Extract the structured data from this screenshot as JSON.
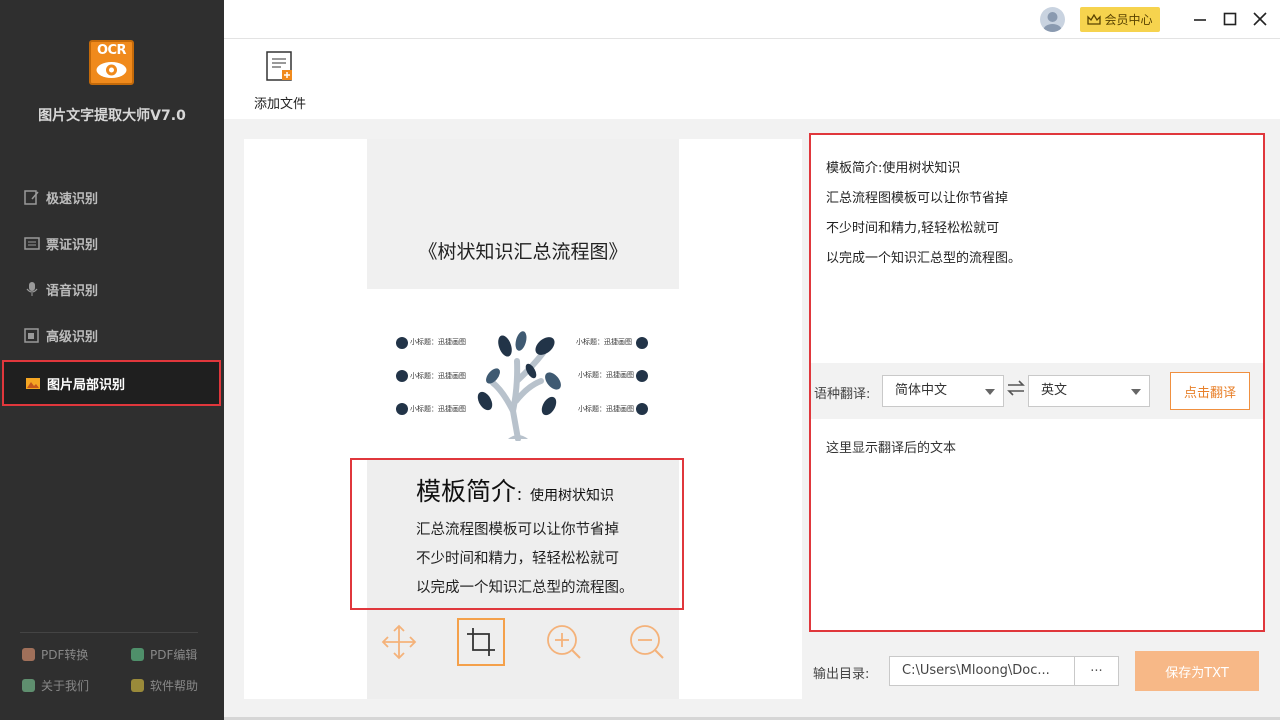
{
  "app": {
    "logo_text": "OCR",
    "title": "图片文字提取大师V7.0"
  },
  "sidebar": {
    "items": [
      {
        "label": "极速识别",
        "icon": "speed-icon"
      },
      {
        "label": "票证识别",
        "icon": "ticket-icon"
      },
      {
        "label": "语音识别",
        "icon": "microphone-icon"
      },
      {
        "label": "高级识别",
        "icon": "advanced-icon"
      },
      {
        "label": "图片局部识别",
        "icon": "image-crop-icon",
        "active": true
      }
    ],
    "bottom_links": [
      {
        "label": "PDF转换",
        "icon": "pdf-convert-icon"
      },
      {
        "label": "PDF编辑",
        "icon": "pdf-edit-icon"
      },
      {
        "label": "关于我们",
        "icon": "about-icon"
      },
      {
        "label": "软件帮助",
        "icon": "help-icon"
      }
    ]
  },
  "titlebar": {
    "member_label": "会员中心"
  },
  "toolbar": {
    "add_file_label": "添加文件"
  },
  "preview": {
    "slide_title": "《树状知识汇总流程图》",
    "mini_labels": [
      "小标题：迅捷画图",
      "小标题：迅捷画图",
      "小标题：迅捷画图",
      "小标题：迅捷画图",
      "小标题：迅捷画图",
      "小标题：迅捷画图"
    ],
    "desc_heading_big": "模板简介",
    "desc_heading_small": "：使用树状知识",
    "desc_lines": [
      "汇总流程图模板可以让你节省掉",
      "不少时间和精力，轻轻松松就可",
      "以完成一个知识汇总型的流程图。"
    ]
  },
  "result": {
    "lines": [
      "模板简介:使用树状知识",
      "汇总流程图模板可以让你节省掉",
      "不少时间和精力,轻轻松松就可",
      "以完成一个知识汇总型的流程图。"
    ],
    "translate_label": "语种翻译:",
    "source_lang": "简体中文",
    "target_lang": "英文",
    "translate_button": "点击翻译",
    "translation_placeholder": "这里显示翻译后的文本"
  },
  "output": {
    "label": "输出目录:",
    "path": "C:\\Users\\Mloong\\Doc...",
    "browse_label": "···",
    "save_button": "保存为TXT"
  },
  "colors": {
    "sidebar_bg": "#2f2f2f",
    "accent_orange": "#f08a1c",
    "highlight_red": "#e0373c",
    "member_yellow": "#f6d34e",
    "save_button_bg": "#f7b887"
  }
}
